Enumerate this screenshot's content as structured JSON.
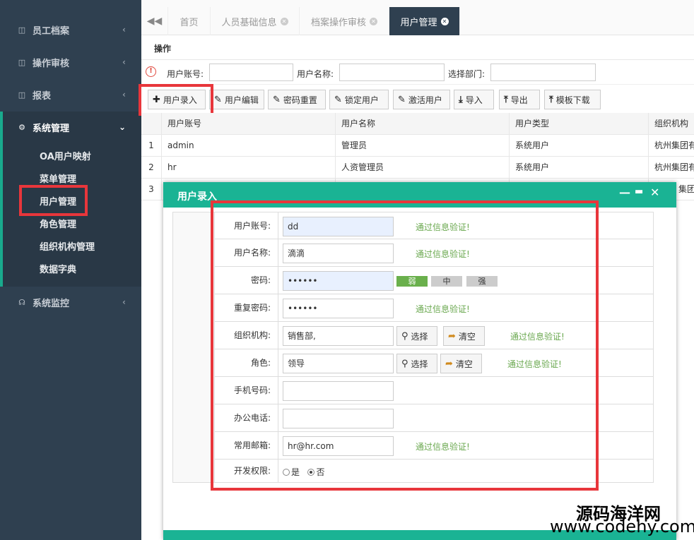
{
  "sidebar": {
    "items": [
      {
        "label": "员工档案",
        "icon": "table-icon"
      },
      {
        "label": "操作审核",
        "icon": "table-icon"
      },
      {
        "label": "报表",
        "icon": "table-icon"
      },
      {
        "label": "系统管理",
        "icon": "gears-icon"
      },
      {
        "label": "系统监控",
        "icon": "headset-icon"
      }
    ],
    "subitems": [
      "OA用户映射",
      "菜单管理",
      "用户管理",
      "角色管理",
      "组织机构管理",
      "数据字典"
    ]
  },
  "tabs": [
    {
      "label": "首页"
    },
    {
      "label": "人员基础信息"
    },
    {
      "label": "档案操作审核"
    },
    {
      "label": "用户管理"
    }
  ],
  "toolbar": {
    "title": "操作",
    "search": {
      "account_label": "用户账号:",
      "name_label": "用户名称:",
      "dept_label": "选择部门:"
    },
    "buttons": [
      "用户录入",
      "用户编辑",
      "密码重置",
      "锁定用户",
      "激活用户",
      "导入",
      "导出",
      "模板下载"
    ]
  },
  "table": {
    "headers": [
      "用户账号",
      "用户名称",
      "用户类型",
      "组织机构"
    ],
    "rows": [
      {
        "no": "1",
        "account": "admin",
        "name": "管理员",
        "type": "系统用户",
        "org": "杭州集团有"
      },
      {
        "no": "2",
        "account": "hr",
        "name": "人资管理员",
        "type": "系统用户",
        "org": "杭州集团有"
      },
      {
        "no": "3",
        "account": "",
        "name": "",
        "type": "",
        "org": "集团有"
      }
    ]
  },
  "modal": {
    "title": "用户录入",
    "ok_text": "通过信息验证!",
    "fields": {
      "account": {
        "label": "用户账号:",
        "value": "dd"
      },
      "name": {
        "label": "用户名称:",
        "value": "滴滴"
      },
      "password": {
        "label": "密码:",
        "value": "••••••"
      },
      "repeat": {
        "label": "重复密码:",
        "value": "••••••"
      },
      "org": {
        "label": "组织机构:",
        "value": "销售部,"
      },
      "role": {
        "label": "角色:",
        "value": "领导"
      },
      "phone": {
        "label": "手机号码:",
        "value": ""
      },
      "office": {
        "label": "办公电话:",
        "value": ""
      },
      "email": {
        "label": "常用邮箱:",
        "value": "hr@hr.com"
      },
      "dev": {
        "label": "开发权限:",
        "yes": "是",
        "no": "否",
        "selected": "否"
      }
    },
    "strength": [
      "弱",
      "中",
      "强"
    ],
    "select_label": "选择",
    "clear_label": "清空"
  },
  "watermark": {
    "line1": "源码海洋网",
    "line2": "www.codehy.com"
  },
  "colors": {
    "sidebar": "#2f4050",
    "accent": "#1ab394",
    "highlight": "#e8363b",
    "ok": "#6aa84f"
  }
}
